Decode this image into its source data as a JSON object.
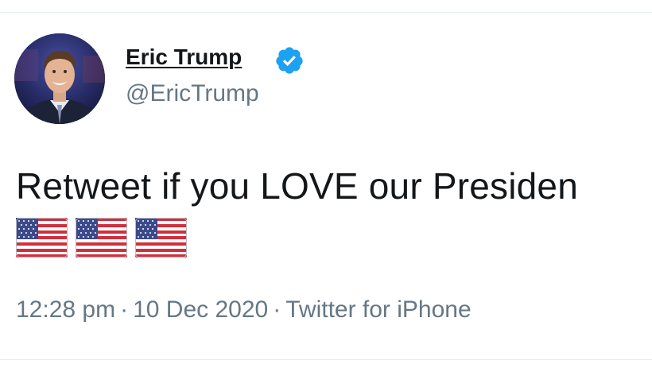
{
  "tweet": {
    "author": {
      "display_name": "Eric Trump",
      "handle": "@EricTrump",
      "verified": true,
      "verified_color": "#1da1f2"
    },
    "text": "Retweet if you LOVE our Presiden",
    "emojis": [
      "us-flag",
      "us-flag",
      "us-flag"
    ],
    "meta": {
      "time": "12:28 pm",
      "separator": "·",
      "date": "10 Dec 2020",
      "source": "Twitter for iPhone"
    }
  },
  "colors": {
    "text_primary": "#14171a",
    "text_secondary": "#657786",
    "divider": "#e6ecf0"
  }
}
